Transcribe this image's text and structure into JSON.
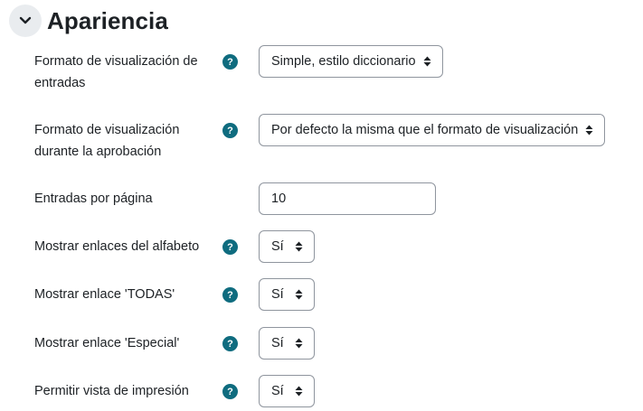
{
  "section": {
    "title": "Apariencia",
    "collapse_icon": "chevron-down-icon"
  },
  "fields": {
    "display_format": {
      "label_line1": "Formato de visualización de",
      "label_line2": "entradas",
      "help": "?",
      "value": "Simple, estilo diccionario"
    },
    "approval_format": {
      "label_line1": "Formato de visualización",
      "label_line2": "durante la aprobación",
      "help": "?",
      "value": "Por defecto la misma que el formato de visualización"
    },
    "entries_per_page": {
      "label": "Entradas por página",
      "value": "10"
    },
    "alphabet_links": {
      "label": "Mostrar enlaces del alfabeto",
      "help": "?",
      "value": "Sí"
    },
    "all_link": {
      "label": "Mostrar enlace 'TODAS'",
      "help": "?",
      "value": "Sí"
    },
    "special_link": {
      "label": "Mostrar enlace 'Especial'",
      "help": "?",
      "value": "Sí"
    },
    "print_view": {
      "label": "Permitir vista de impresión",
      "help": "?",
      "value": "Sí"
    }
  },
  "colors": {
    "help_icon_bg": "#0f6c7f",
    "collapse_bg": "#e9ecef",
    "border": "#8f959e"
  }
}
